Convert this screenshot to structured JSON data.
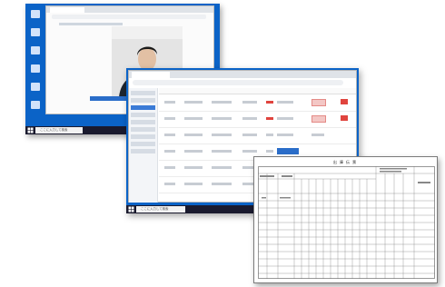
{
  "screen1": {
    "browser_tab_label": "",
    "video_panel": "webcam-feed",
    "taskbar_search_placeholder": "ここに入力して検索"
  },
  "screen2": {
    "browser_tab_label": "",
    "address_text": "",
    "taskbar_search_placeholder": "ここに入力して検索"
  },
  "paper": {
    "title": "出 庫 伝 票"
  },
  "colors": {
    "desktop_blue": "#0b63c7",
    "taskbar": "#1a1a2e",
    "accent_red": "#e0443e",
    "accent_blue": "#2a6dc9"
  }
}
